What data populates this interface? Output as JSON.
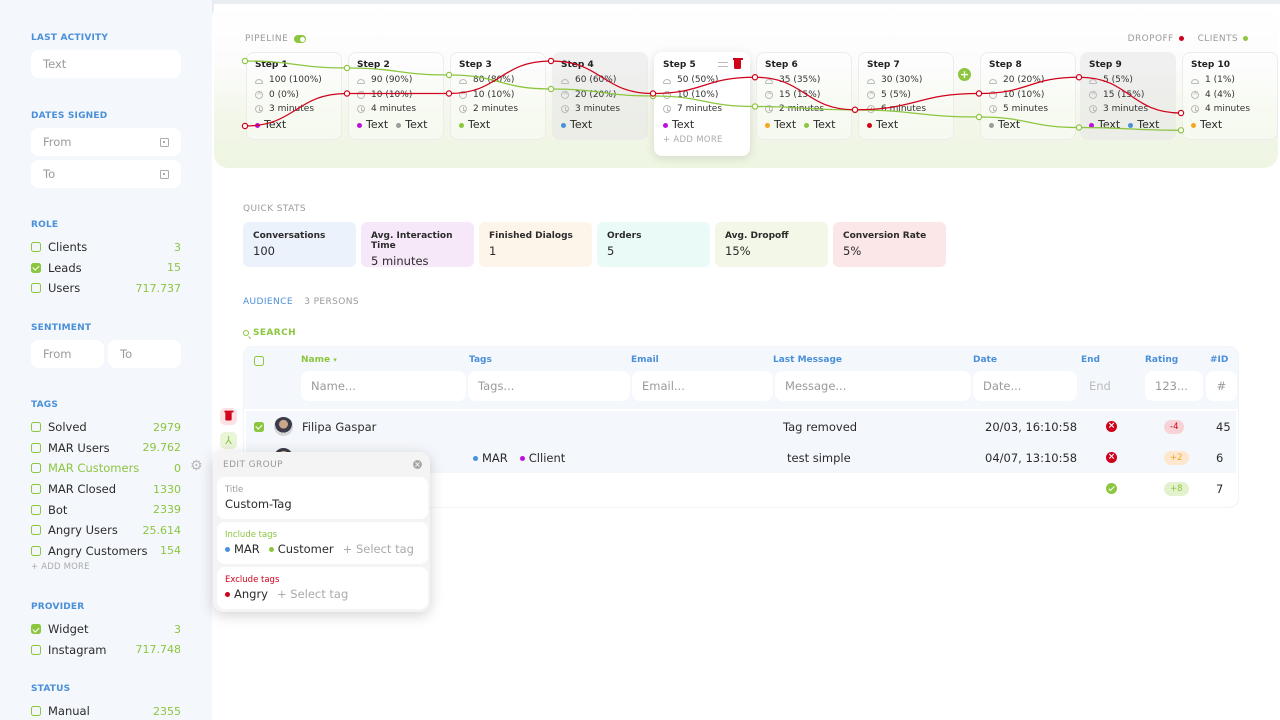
{
  "sidebar": {
    "last_activity": {
      "heading": "LAST ACTIVITY",
      "placeholder": "Text"
    },
    "dates_signed": {
      "heading": "DATES SIGNED",
      "from": "From",
      "to": "To"
    },
    "role": {
      "heading": "ROLE",
      "items": [
        {
          "label": "Clients",
          "count": "3",
          "checked": false
        },
        {
          "label": "Leads",
          "count": "15",
          "checked": true
        },
        {
          "label": "Users",
          "count": "717.737",
          "checked": false
        }
      ]
    },
    "sentiment": {
      "heading": "SENTIMENT",
      "from": "From",
      "to": "To"
    },
    "tags": {
      "heading": "TAGS",
      "items": [
        {
          "label": "Solved",
          "count": "2979"
        },
        {
          "label": "MAR Users",
          "count": "29.762"
        },
        {
          "label": "MAR Customers",
          "count": "0",
          "active": true
        },
        {
          "label": "MAR Closed",
          "count": "1330"
        },
        {
          "label": "Bot",
          "count": "2339"
        },
        {
          "label": "Angry Users",
          "count": "25.614"
        },
        {
          "label": "Angry Customers",
          "count": "154"
        }
      ],
      "add_more": "+ ADD MORE"
    },
    "provider": {
      "heading": "PROVIDER",
      "items": [
        {
          "label": "Widget",
          "count": "3",
          "checked": true
        },
        {
          "label": "Instagram",
          "count": "717.748",
          "checked": false
        }
      ]
    },
    "status": {
      "heading": "STATUS",
      "items": [
        {
          "label": "Manual",
          "count": "2355",
          "checked": false
        }
      ]
    }
  },
  "pipeline": {
    "label": "PIPELINE",
    "enabled": true,
    "legend": {
      "dropoff": "DROPOFF",
      "clients": "CLIENTS"
    },
    "colors": {
      "dropoff": "#d0021b",
      "clients": "#8cc63f"
    },
    "add_more": "+ ADD MORE",
    "steps": [
      {
        "title": "Step 1",
        "users": "100 (100%)",
        "dropped": "0 (0%)",
        "time": "3 minutes",
        "tags": [
          {
            "label": "Text",
            "color": "#bd10e0"
          }
        ]
      },
      {
        "title": "Step 2",
        "users": "90 (90%)",
        "dropped": "10 (10%)",
        "time": "4 minutes",
        "tags": [
          {
            "label": "Text",
            "color": "#bd10e0"
          },
          {
            "label": "Text",
            "color": "#9b9b9b"
          }
        ]
      },
      {
        "title": "Step 3",
        "users": "80 (80%)",
        "dropped": "10 (10%)",
        "time": "2 minutes",
        "tags": [
          {
            "label": "Text",
            "color": "#8cc63f"
          }
        ]
      },
      {
        "title": "Step 4",
        "users": "60 (60%)",
        "dropped": "20 (20%)",
        "time": "3 minutes",
        "tags": [
          {
            "label": "Text",
            "color": "#4a90d9"
          }
        ]
      },
      {
        "title": "Step 5",
        "users": "50 (50%)",
        "dropped": "10 (10%)",
        "time": "7 minutes",
        "tags": [
          {
            "label": "Text",
            "color": "#bd10e0"
          }
        ]
      },
      {
        "title": "Step 6",
        "users": "35 (35%)",
        "dropped": "15 (15%)",
        "time": "2 minutes",
        "tags": [
          {
            "label": "Text",
            "color": "#f5a623"
          },
          {
            "label": "Text",
            "color": "#8cc63f"
          }
        ]
      },
      {
        "title": "Step 7",
        "users": "30 (30%)",
        "dropped": "5 (5%)",
        "time": "6 minutes",
        "tags": [
          {
            "label": "Text",
            "color": "#d0021b"
          }
        ]
      },
      {
        "title": "Step 8",
        "users": "20 (20%)",
        "dropped": "10 (10%)",
        "time": "5 minutes",
        "tags": [
          {
            "label": "Text",
            "color": "#9b9b9b"
          }
        ]
      },
      {
        "title": "Step 9",
        "users": "5 (5%)",
        "dropped": "15 (15%)",
        "time": "3 minutes",
        "tags": [
          {
            "label": "Text",
            "color": "#bd10e0"
          },
          {
            "label": "Text",
            "color": "#4a90d9"
          }
        ]
      },
      {
        "title": "Step 10",
        "users": "1 (1%)",
        "dropped": "4 (4%)",
        "time": "4 minutes",
        "tags": [
          {
            "label": "Text",
            "color": "#f5a623"
          }
        ]
      }
    ]
  },
  "chart_data": {
    "type": "line",
    "categories": [
      "Step 1",
      "Step 2",
      "Step 3",
      "Step 4",
      "Step 5",
      "Step 6",
      "Step 7",
      "Step 8",
      "Step 9",
      "Step 10"
    ],
    "series": [
      {
        "name": "Clients",
        "values": [
          100,
          90,
          80,
          60,
          50,
          35,
          30,
          20,
          5,
          1
        ]
      },
      {
        "name": "Dropoff",
        "values": [
          0,
          10,
          10,
          20,
          10,
          15,
          5,
          10,
          15,
          4
        ]
      }
    ]
  },
  "quick_stats": {
    "label": "QUICK STATS",
    "cards": [
      {
        "title": "Conversations",
        "value": "100",
        "bg": "#ebf2fc"
      },
      {
        "title": "Avg. Interaction Time",
        "value": "5 minutes",
        "bg": "#f7e8f9"
      },
      {
        "title": "Finished Dialogs",
        "value": "1",
        "bg": "#fdf5ea"
      },
      {
        "title": "Orders",
        "value": "5",
        "bg": "#eafaf7"
      },
      {
        "title": "Avg. Dropoff",
        "value": "15%",
        "bg": "#f2f7e8"
      },
      {
        "title": "Conversion Rate",
        "value": "5%",
        "bg": "#fbe6e8"
      }
    ]
  },
  "audience": {
    "label": "AUDIENCE",
    "count": "3 PERSONS",
    "search": "SEARCH",
    "columns": {
      "name": "Name",
      "tags": "Tags",
      "email": "Email",
      "last_message": "Last Message",
      "date": "Date",
      "end": "End",
      "rating": "Rating",
      "id": "#ID"
    },
    "filters": {
      "name": "Name...",
      "tags": "Tags...",
      "email": "Email...",
      "message": "Message...",
      "date": "Date...",
      "end": "End",
      "rating": "123...",
      "id": "#"
    },
    "rows": [
      {
        "name": "Filipa Gaspar",
        "tags": [],
        "message": "Tag removed",
        "date": "20/03, 16:10:58",
        "end": "failed",
        "rating": "-4",
        "id": "45",
        "checked": true
      },
      {
        "name": "",
        "tags": [
          {
            "label": "MAR",
            "color": "#4a90d9"
          },
          {
            "label": "Cllient",
            "color": "#bd10e0"
          }
        ],
        "message": "test simple",
        "date": "04/07, 13:10:58",
        "end": "failed",
        "rating": "+2",
        "id": "6",
        "checked": false
      },
      {
        "name": "",
        "tags": [],
        "message": "",
        "date": "",
        "end": "ok",
        "rating": "+8",
        "id": "7",
        "checked": false
      }
    ]
  },
  "edit_group": {
    "heading": "EDIT GROUP",
    "title_label": "Title",
    "title_value": "Custom-Tag",
    "include_label": "Include tags",
    "include_tags": [
      {
        "label": "MAR",
        "color": "#4a90d9"
      },
      {
        "label": "Customer",
        "color": "#8cc63f"
      }
    ],
    "exclude_label": "Exclude tags",
    "exclude_tags": [
      {
        "label": "Angry",
        "color": "#d0021b"
      }
    ],
    "select_placeholder": "+ Select tag"
  }
}
